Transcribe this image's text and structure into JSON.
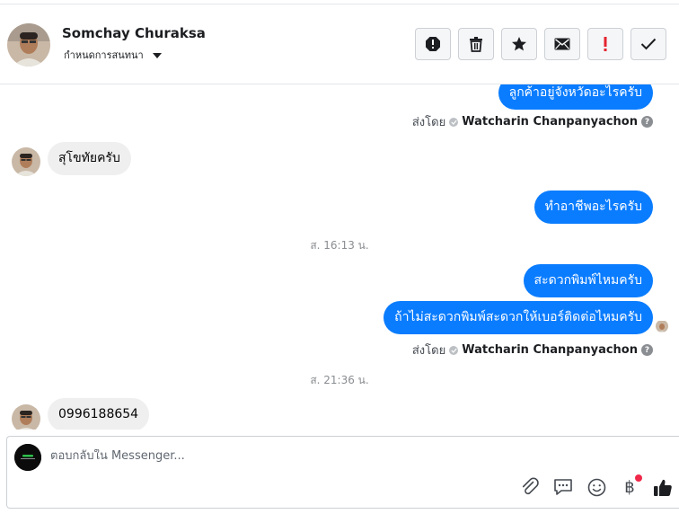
{
  "header": {
    "contact_name": "Somchay Churaksa",
    "convo_settings_label": "กำหนดการสนทนา",
    "toolbar_icons": [
      "spam-icon",
      "trash-icon",
      "star-icon",
      "envelope-icon",
      "follow-up-icon",
      "done-check-icon"
    ]
  },
  "messages": {
    "out_1": "ลูกค้าอยู่จังหวัดอะไรครับ",
    "sent_by_label_1": "ส่งโดย",
    "sent_by_name_1": "Watcharin Chanpanyachon",
    "in_1": "สุโขทัยครับ",
    "out_2": "ทำอาชีพอะไรครับ",
    "time_1": "ส. 16:13 น.",
    "out_3": "สะดวกพิมพ์ไหมครับ",
    "out_4": "ถ้าไม่สะดวกพิมพ์สะดวกให้เบอร์ติดต่อไหมครับ",
    "sent_by_label_2": "ส่งโดย",
    "sent_by_name_2": "Watcharin Chanpanyachon",
    "time_2": "ส. 21:36 น.",
    "in_2": "0996188654"
  },
  "composer": {
    "placeholder": "ตอบกลับใน Messenger...",
    "tools": [
      "paperclip-icon",
      "saved-reply-icon",
      "emoji-icon",
      "baht-payment-icon",
      "thumbs-up-icon"
    ],
    "baht_symbol": "฿",
    "notification_color": "#f02849"
  },
  "colors": {
    "outgoing_bubble": "#0a7cff",
    "incoming_bubble": "#efefef"
  }
}
